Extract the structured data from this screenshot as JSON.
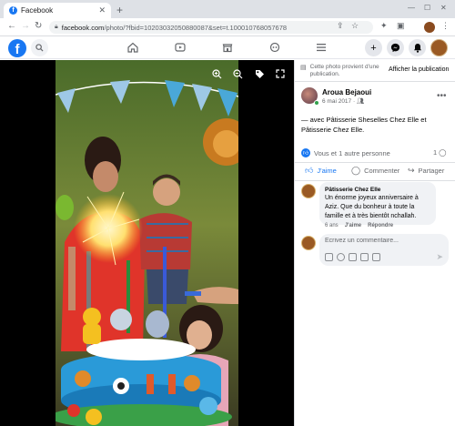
{
  "browser": {
    "tab_title": "Facebook",
    "tab_favicon": "f",
    "url_host": "facebook.com",
    "url_path": "/photo/?fbid=10203032050880087&set=t.100010768057678",
    "colors": {
      "tabbar": "#dee1e6",
      "omnibox": "#f1f3f4"
    }
  },
  "fb_nav": {
    "logo": "f",
    "icons": [
      "search-icon",
      "home-icon",
      "video-icon",
      "marketplace-icon",
      "gaming-icon",
      "menu-icon",
      "plus-icon",
      "messenger-icon",
      "bell-icon"
    ],
    "brand_color": "#1877f2"
  },
  "notice": {
    "text": "Cette photo provient d'une publication.",
    "link": "Afficher la publication"
  },
  "post": {
    "author": "Aroua Bejaoui",
    "date": "6 mai 2017",
    "privacy_icon": "friends-icon",
    "text": "— avec Pâtisserie Sheselles Chez Elle et Pâtisserie Chez Elle.",
    "reactions": "Vous et 1 autre personne",
    "comment_count": "1",
    "actions": {
      "like": "J'aime",
      "comment": "Commenter",
      "share": "Partager"
    }
  },
  "comment": {
    "author": "Pâtisserie Chez Elle",
    "text": "Un énorme joyeux anniversaire à Aziz. Que du bonheur à toute la famille et à très bientôt nchallah.",
    "time": "6 ans",
    "like": "J'aime",
    "reply": "Répondre"
  },
  "composer": {
    "placeholder": "Écrivez un commentaire..."
  }
}
